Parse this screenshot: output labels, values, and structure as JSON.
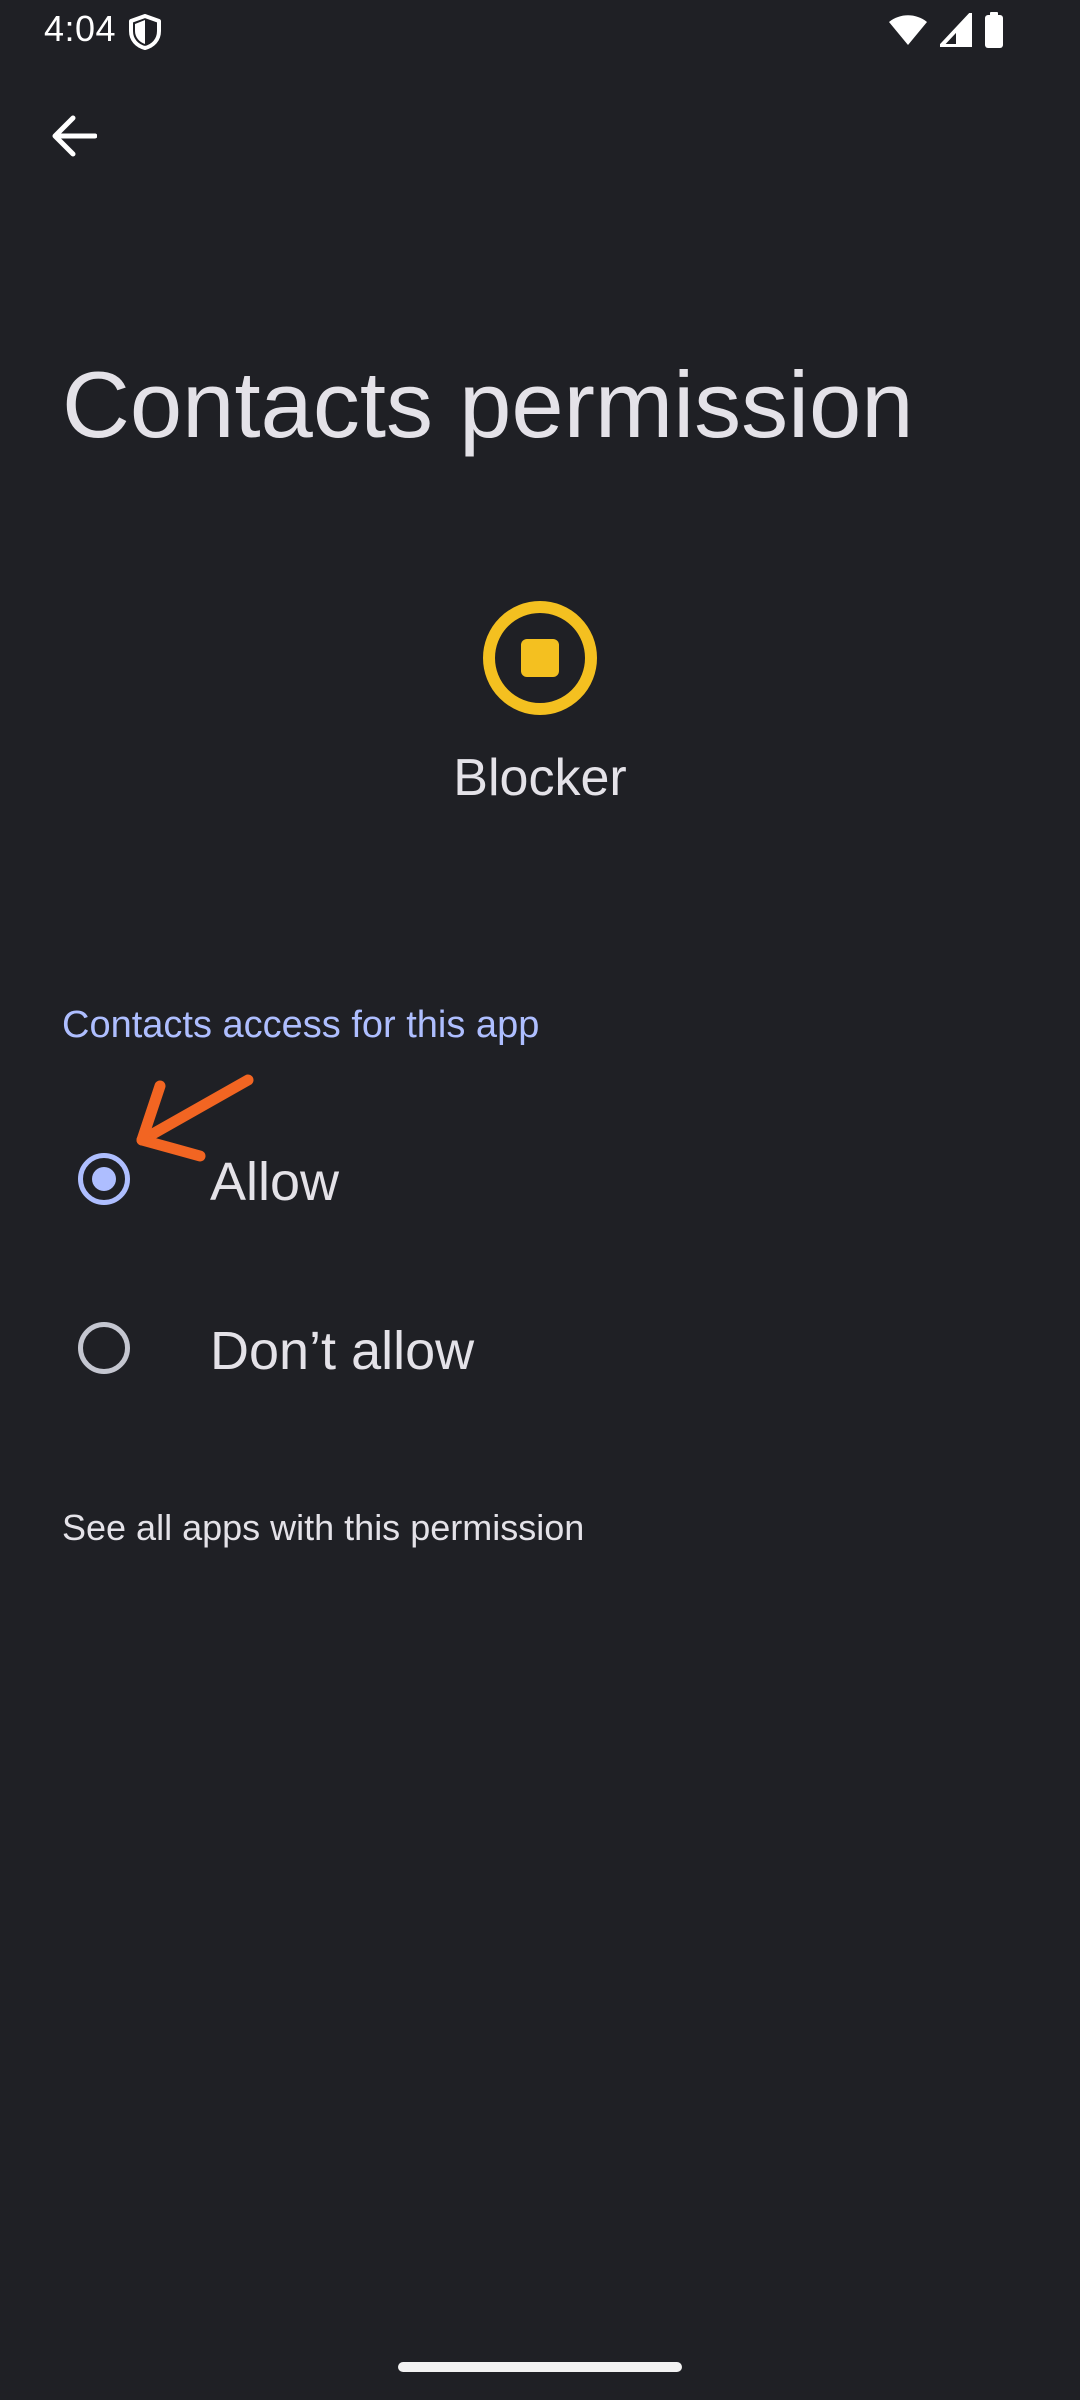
{
  "status_bar": {
    "time": "4:04",
    "icons": [
      "shield-icon",
      "wifi-icon",
      "signal-icon",
      "battery-icon"
    ]
  },
  "header": {
    "back_icon": "arrow-back-icon",
    "title": "Contacts permission"
  },
  "app": {
    "icon": "blocker-app-icon",
    "name": "Blocker",
    "icon_color": "#f4c020"
  },
  "section": {
    "header": "Contacts access for this app"
  },
  "options": [
    {
      "label": "Allow",
      "selected": true
    },
    {
      "label": "Don’t allow",
      "selected": false
    }
  ],
  "link": {
    "label": "See all apps with this permission"
  },
  "colors": {
    "background": "#1f2025",
    "accent": "#aebeff",
    "text": "#e4e2e8",
    "annotation": "#f26522"
  }
}
